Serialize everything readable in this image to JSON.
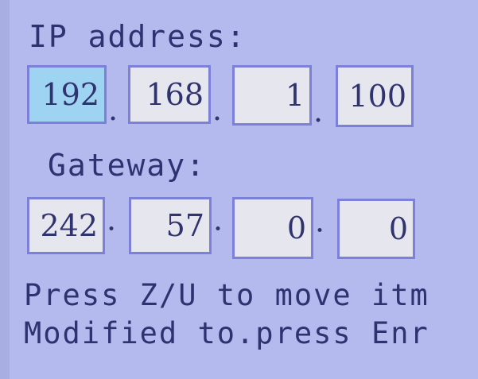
{
  "ip": {
    "label": "IP address:",
    "octets": [
      "192",
      "168",
      "1",
      "100"
    ],
    "separator": ".",
    "selected_index": 0
  },
  "gateway": {
    "label": "Gateway:",
    "octets": [
      "242",
      "57",
      "0",
      "0"
    ],
    "separator": "·"
  },
  "help": {
    "line1": "Press Z/U to move itm",
    "line2": "Modified to.press Enr"
  },
  "colors": {
    "screen_background": "#b4b9ee",
    "field_background": "#e6e6ee",
    "selected_field_background": "#9fd3f2",
    "field_border": "#7d80d8",
    "text": "#2f3270"
  }
}
